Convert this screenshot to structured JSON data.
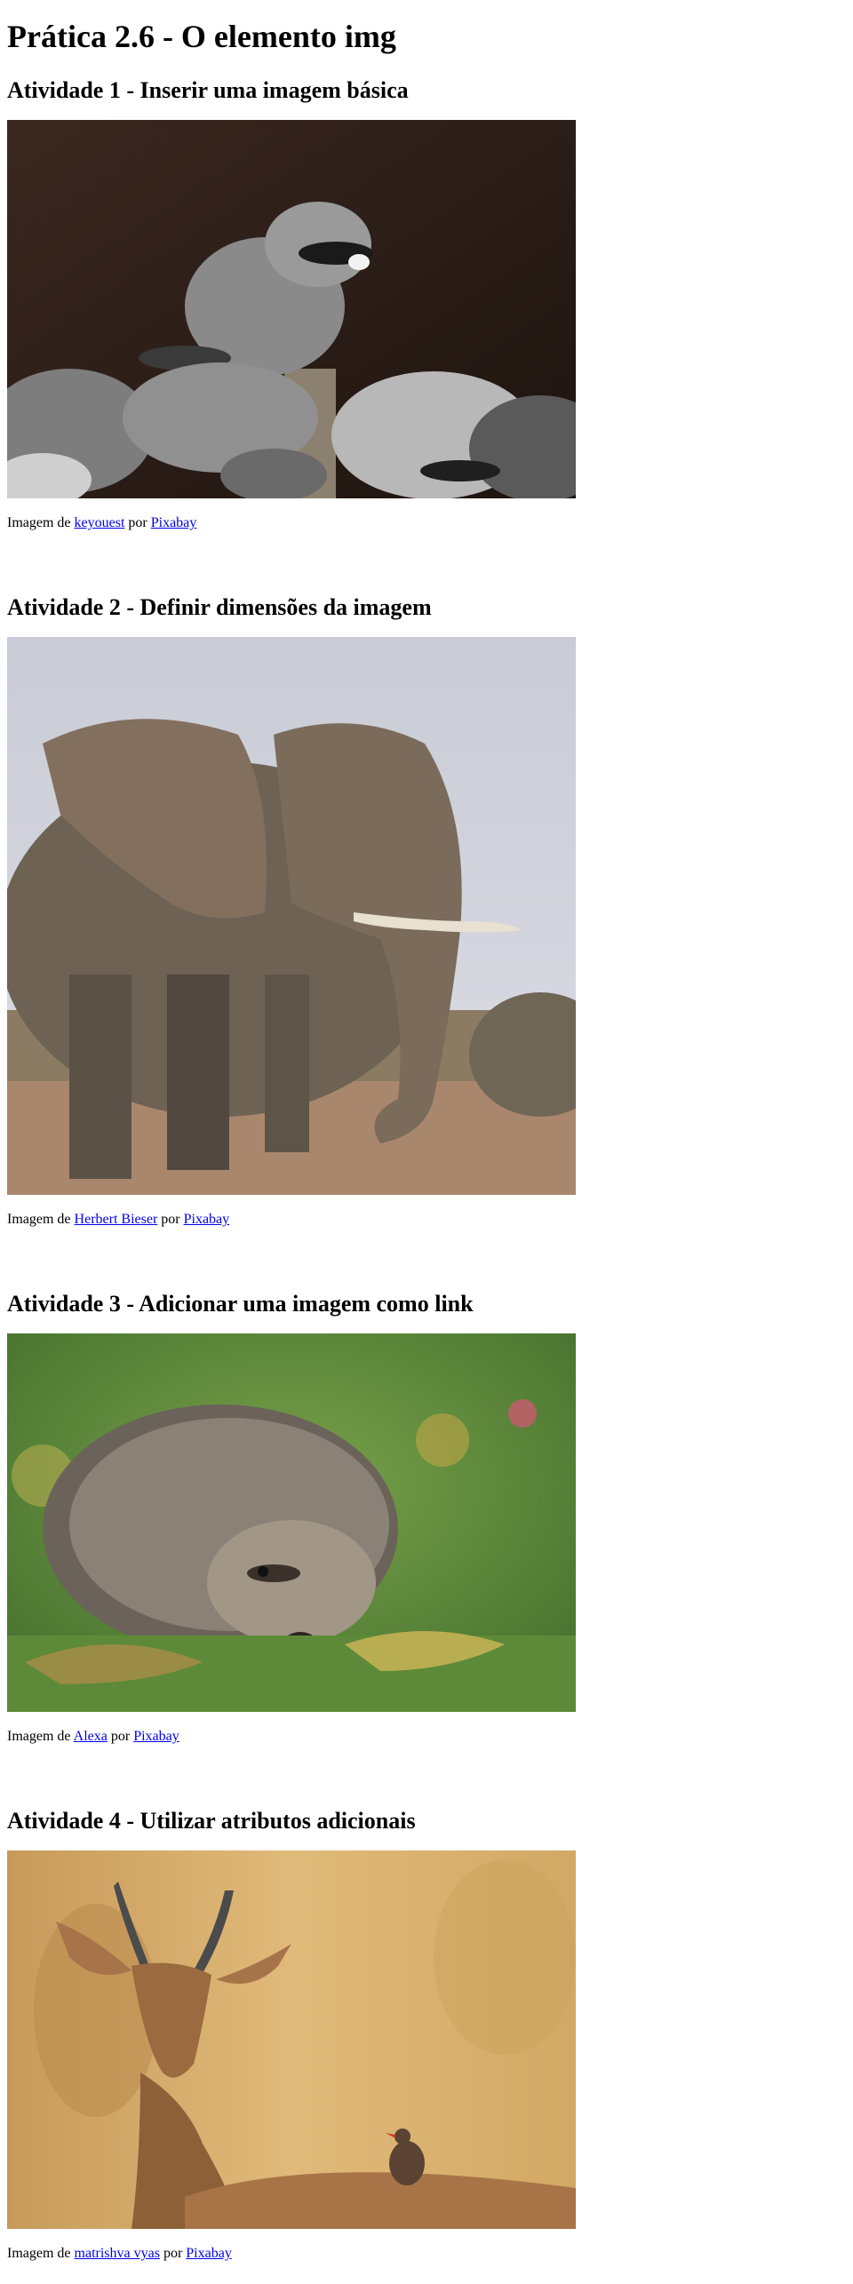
{
  "page": {
    "title": "Prática 2.6 - O elemento img"
  },
  "sections": [
    {
      "heading": "Atividade 1 - Inserir uma imagem básica",
      "image_subject": "raccoon",
      "credit": {
        "prefix": "Imagem de",
        "author": "keyouest",
        "middle": "por",
        "source": "Pixabay"
      }
    },
    {
      "heading": "Atividade 2 - Definir dimensões da imagem",
      "image_subject": "elephant",
      "credit": {
        "prefix": "Imagem de",
        "author": "Herbert Bieser",
        "middle": "por",
        "source": "Pixabay"
      }
    },
    {
      "heading": "Atividade 3 - Adicionar uma imagem como link",
      "image_subject": "hedgehog",
      "credit": {
        "prefix": "Imagem de",
        "author": "Alexa",
        "middle": "por",
        "source": "Pixabay"
      }
    },
    {
      "heading": "Atividade 4 - Utilizar atributos adicionais",
      "image_subject": "impala",
      "credit": {
        "prefix": "Imagem de",
        "author": "matrishva vyas",
        "middle": "por",
        "source": "Pixabay"
      }
    }
  ],
  "colors": {
    "link": "#0000ee",
    "text": "#000000",
    "background": "#ffffff"
  }
}
